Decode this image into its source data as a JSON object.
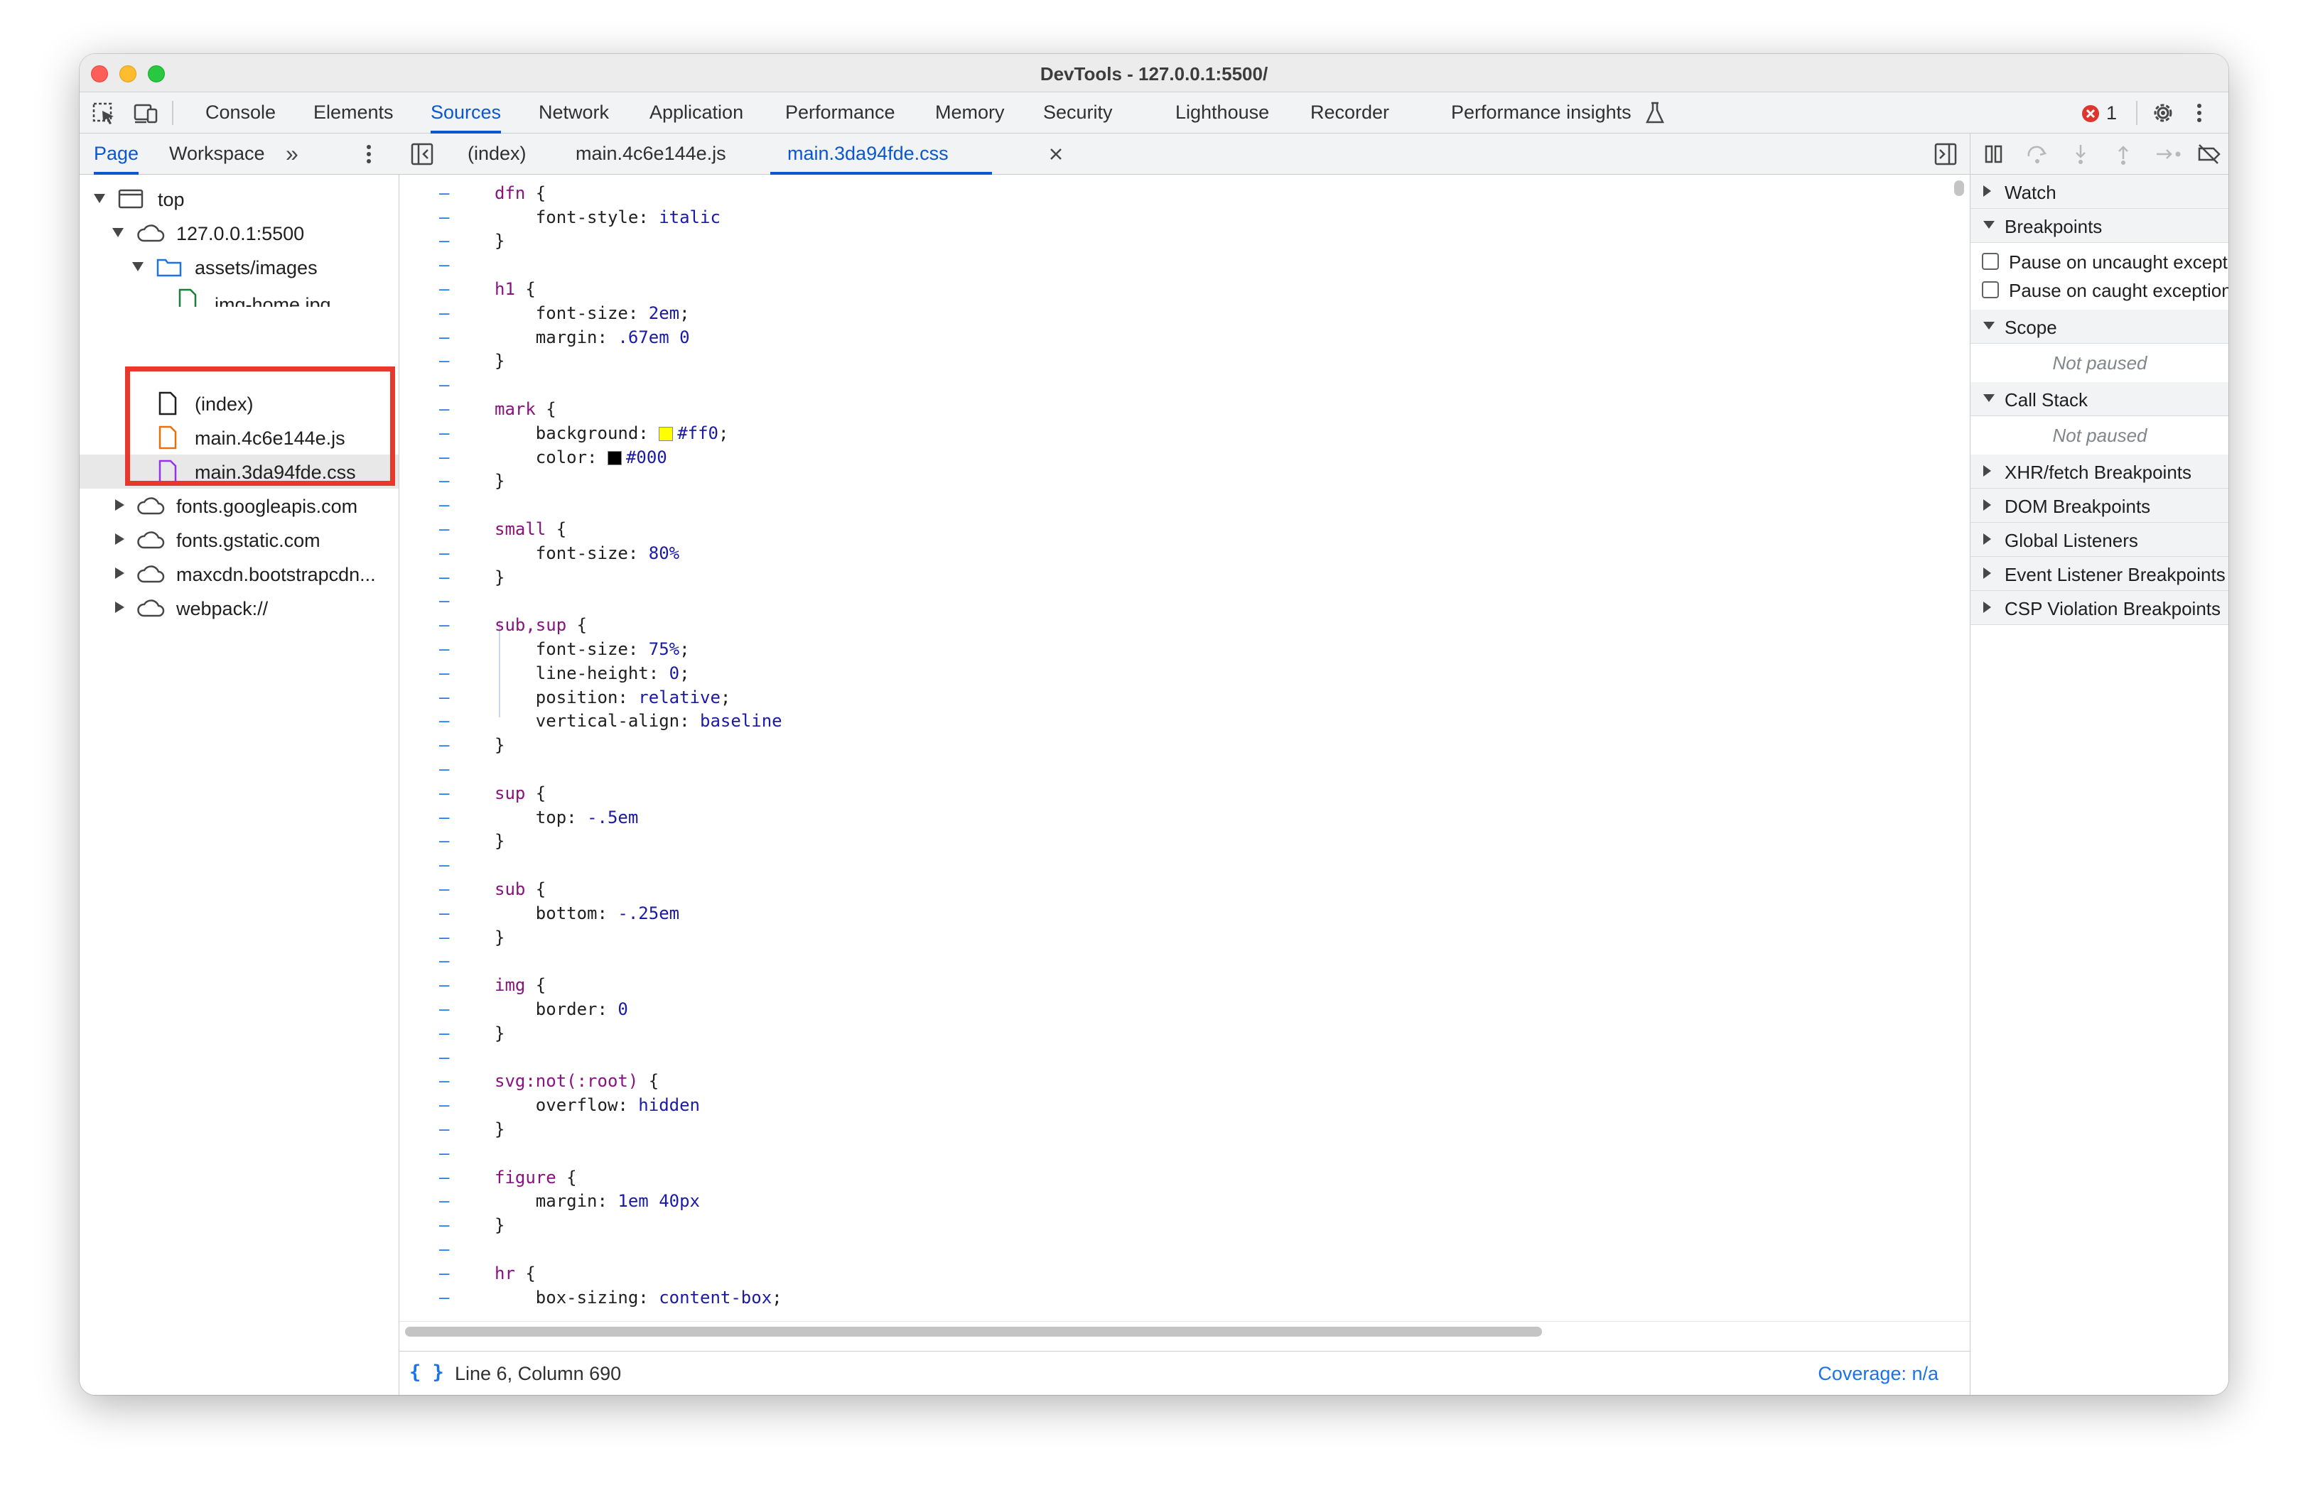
{
  "window": {
    "title": "DevTools - 127.0.0.1:5500/"
  },
  "main_tabs": [
    "Console",
    "Elements",
    "Sources",
    "Network",
    "Application",
    "Performance",
    "Memory",
    "Security",
    "Lighthouse",
    "Recorder",
    "Performance insights"
  ],
  "active_main_tab": "Sources",
  "error_count": "1",
  "navigator": {
    "tabs": [
      "Page",
      "Workspace"
    ],
    "more": "»",
    "tree": [
      {
        "label": "top",
        "level": 0,
        "type": "frame",
        "expanded": true
      },
      {
        "label": "127.0.0.1:5500",
        "level": 1,
        "type": "domain",
        "expanded": true
      },
      {
        "label": "assets/images",
        "level": 2,
        "type": "folder",
        "expanded": true
      },
      {
        "label": "img-home.jpg",
        "level": 3,
        "type": "image"
      },
      {
        "label": "(index)",
        "level": 2,
        "type": "document"
      },
      {
        "label": "main.4c6e144e.js",
        "level": 2,
        "type": "script"
      },
      {
        "label": "main.3da94fde.css",
        "level": 2,
        "type": "stylesheet",
        "selected": true
      },
      {
        "label": "fonts.googleapis.com",
        "level": 1,
        "type": "domain",
        "expanded": false
      },
      {
        "label": "fonts.gstatic.com",
        "level": 1,
        "type": "domain",
        "expanded": false
      },
      {
        "label": "maxcdn.bootstrapcdn...",
        "level": 1,
        "type": "domain",
        "expanded": false
      },
      {
        "label": "webpack://",
        "level": 1,
        "type": "domain",
        "expanded": false
      }
    ]
  },
  "editor": {
    "tabs": [
      "(index)",
      "main.4c6e144e.js",
      "main.3da94fde.css"
    ],
    "active_tab": "main.3da94fde.css",
    "code_lines": [
      "",
      "dfn {",
      "    font-style: italic",
      "}",
      "",
      "h1 {",
      "    font-size: 2em;",
      "    margin: .67em 0",
      "}",
      "",
      "mark {",
      "    background: #ff0;",
      "    color: #000",
      "}",
      "",
      "small {",
      "    font-size: 80%",
      "}",
      "",
      "sub,sup {",
      "    font-size: 75%;",
      "    line-height: 0;",
      "    position: relative;",
      "    vertical-align: baseline",
      "}",
      "",
      "sup {",
      "    top: -.5em",
      "}",
      "",
      "sub {",
      "    bottom: -.25em",
      "}",
      "",
      "img {",
      "    border: 0",
      "}",
      "",
      "svg:not(:root) {",
      "    overflow: hidden",
      "}",
      "",
      "figure {",
      "    margin: 1em 40px",
      "}",
      "",
      "hr {",
      "    box-sizing: content-box;"
    ],
    "gutter_marker": "–",
    "status": "Line 6, Column 690",
    "coverage": "Coverage: n/a",
    "format_icon": "{ }"
  },
  "debugger": {
    "sections": {
      "watch": "Watch",
      "breakpoints": "Breakpoints",
      "pause_uncaught": "Pause on uncaught exceptions",
      "pause_caught": "Pause on caught exceptions",
      "scope": "Scope",
      "scope_state": "Not paused",
      "call_stack": "Call Stack",
      "call_stack_state": "Not paused",
      "xhr": "XHR/fetch Breakpoints",
      "dom": "DOM Breakpoints",
      "global": "Global Listeners",
      "event": "Event Listener Breakpoints",
      "csp": "CSP Violation Breakpoints"
    }
  },
  "colors": {
    "accent": "#0b57d0",
    "highlight_box": "#e8382b",
    "error": "#dc362e",
    "swatch_mark_bg": "#ffff00",
    "swatch_mark_color": "#000000"
  }
}
